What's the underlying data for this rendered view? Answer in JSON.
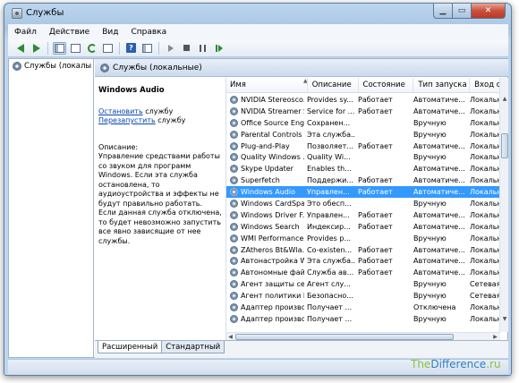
{
  "window": {
    "title": "Службы"
  },
  "menu": [
    "Файл",
    "Действие",
    "Вид",
    "Справка"
  ],
  "tree": {
    "item": "Службы (локалы"
  },
  "main_header": {
    "title": "Службы (локальные)"
  },
  "details": {
    "service_name": "Windows Audio",
    "stop_link": "Остановить",
    "stop_suffix": " службу",
    "restart_link": "Перезапустить",
    "restart_suffix": " службу",
    "description_label": "Описание:",
    "description_text": "Управление средствами работы со звуком для программ Windows. Если эта служба остановлена, то аудиоустройства и эффекты не будут правильно работать. Если данная служба отключена, то будет невозможно запустить все явно зависящие от нее службы."
  },
  "columns": [
    "Имя",
    "Описание",
    "Состояние",
    "Тип запуска",
    "Вход от и"
  ],
  "rows": [
    {
      "name": "NVIDIA Stereosco...",
      "desc": "Provides sy...",
      "status": "Работает",
      "start": "Автоматиче...",
      "logon": "Локальн"
    },
    {
      "name": "NVIDIA Streamer S...",
      "desc": "Service for ...",
      "status": "Работает",
      "start": "Автоматиче...",
      "logon": "Локальн"
    },
    {
      "name": "Office Source Engi...",
      "desc": "Сохранен...",
      "status": "",
      "start": "Вручную",
      "logon": "Локальн"
    },
    {
      "name": "Parental Controls",
      "desc": "Эта служба...",
      "status": "",
      "start": "Вручную",
      "logon": "Локальн"
    },
    {
      "name": "Plug-and-Play",
      "desc": "Позволяет...",
      "status": "Работает",
      "start": "Автоматиче...",
      "logon": "Локальн"
    },
    {
      "name": "Quality Windows ...",
      "desc": "Quality Wi...",
      "status": "",
      "start": "Вручную",
      "logon": "Локальн"
    },
    {
      "name": "Skype Updater",
      "desc": "Enables th...",
      "status": "",
      "start": "Автоматиче...",
      "logon": "Локальн"
    },
    {
      "name": "Superfetch",
      "desc": "Поддержи...",
      "status": "Работает",
      "start": "Автоматиче...",
      "logon": "Локальн"
    },
    {
      "name": "Windows Audio",
      "desc": "Управлен...",
      "status": "Работает",
      "start": "Автоматиче...",
      "logon": "Локальн",
      "selected": true
    },
    {
      "name": "Windows CardSpa...",
      "desc": "Это обесп...",
      "status": "",
      "start": "Вручную",
      "logon": "Локальн"
    },
    {
      "name": "Windows Driver F...",
      "desc": "Управлен...",
      "status": "Работает",
      "start": "Автоматиче...",
      "logon": "Локальн"
    },
    {
      "name": "Windows Search",
      "desc": "Индексир...",
      "status": "Работает",
      "start": "Автоматиче...",
      "logon": "Локальн"
    },
    {
      "name": "WMI Performance...",
      "desc": "Provides p...",
      "status": "",
      "start": "Вручную",
      "logon": "Локальн"
    },
    {
      "name": "ZAtheros Bt&Wla...",
      "desc": "Co-existen...",
      "status": "Работает",
      "start": "Автоматиче...",
      "logon": "Локальн"
    },
    {
      "name": "Автонастройка W...",
      "desc": "Эта служба...",
      "status": "Работает",
      "start": "Автоматиче...",
      "logon": "Локальн"
    },
    {
      "name": "Автономные фай...",
      "desc": "Служба ав...",
      "status": "Работает",
      "start": "Автоматиче...",
      "logon": "Локальн"
    },
    {
      "name": "Агент защиты сет...",
      "desc": "Агент слу...",
      "status": "",
      "start": "Вручную",
      "logon": "Сетевая с"
    },
    {
      "name": "Агент политики I...",
      "desc": "Безопасно...",
      "status": "",
      "start": "Вручную",
      "logon": "Сетевая с"
    },
    {
      "name": "Адаптер произво...",
      "desc": "Получает ...",
      "status": "",
      "start": "Отключена",
      "logon": "Локальн"
    },
    {
      "name": "Адаптер произво...",
      "desc": "Получает ...",
      "status": "",
      "start": "Вручную",
      "logon": "Локальн"
    }
  ],
  "tabs": [
    "Расширенный",
    "Стандартный"
  ],
  "watermark": {
    "part1": "The",
    "part2": "Difference",
    "part3": ".ru"
  },
  "colors": {
    "selection": "#3399ff",
    "link": "#0645ad"
  }
}
